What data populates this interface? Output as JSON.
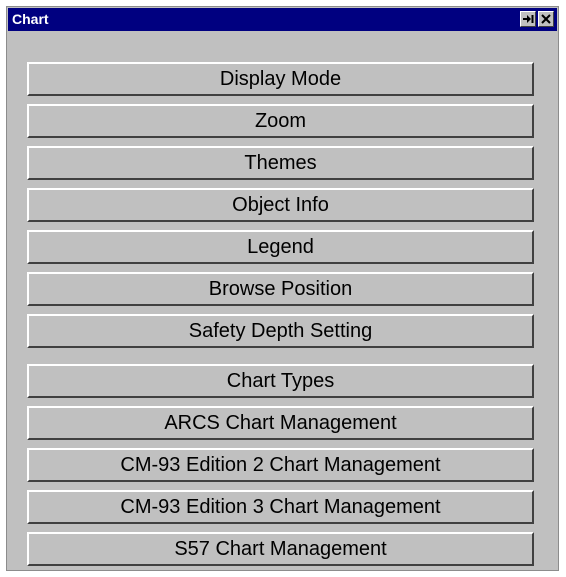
{
  "window": {
    "title": "Chart",
    "pin_icon": "pin-icon",
    "close_icon": "close-icon"
  },
  "menu": {
    "group1": [
      {
        "label": "Display Mode"
      },
      {
        "label": "Zoom"
      },
      {
        "label": "Themes"
      },
      {
        "label": "Object Info"
      },
      {
        "label": "Legend"
      },
      {
        "label": "Browse Position"
      },
      {
        "label": "Safety Depth Setting"
      }
    ],
    "group2": [
      {
        "label": "Chart Types"
      },
      {
        "label": "ARCS Chart Management"
      },
      {
        "label": "CM-93 Edition 2 Chart Management"
      },
      {
        "label": "CM-93 Edition 3 Chart Management"
      },
      {
        "label": "S57 Chart Management"
      }
    ]
  },
  "colors": {
    "titlebar": "#000080",
    "panel": "#c0c0c0"
  }
}
